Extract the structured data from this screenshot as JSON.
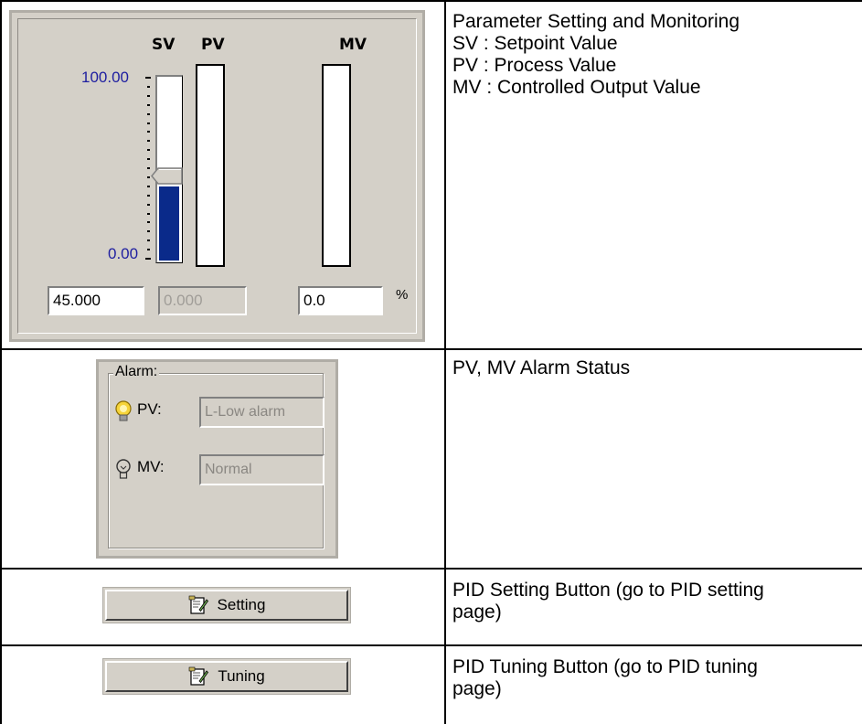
{
  "rows": [
    {
      "description": [
        "Parameter Setting and Monitoring",
        "SV : Setpoint Value",
        "PV : Process Value",
        "MV : Controlled Output Value"
      ]
    },
    {
      "description": [
        "PV, MV Alarm Status"
      ]
    },
    {
      "description": [
        "PID Setting Button (go to PID setting",
        "page)"
      ]
    },
    {
      "description": [
        "PID Tuning Button (go to PID tuning",
        "page)"
      ]
    }
  ],
  "monitor": {
    "headers": {
      "sv": "SV",
      "pv": "PV",
      "mv": "MV"
    },
    "scale_max": "100.00",
    "scale_min": "0.00",
    "sv_value": "45.000",
    "pv_value": "0.000",
    "mv_value": "0.0",
    "unit": "%",
    "sv_level": 0.45,
    "pv_level": 0.0,
    "mv_level": 0.0,
    "scale_color": "#1e1ea0",
    "fill_color": "#0a2a8a"
  },
  "alarm": {
    "group_label": "Alarm:",
    "pv_label": "PV:",
    "pv_status": "L-Low alarm",
    "mv_label": "MV:",
    "mv_status": "Normal",
    "pv_icon": "bulb-lit-icon",
    "mv_icon": "bulb-off-icon"
  },
  "buttons": {
    "setting_label": "Setting",
    "tuning_label": "Tuning",
    "icon": "document-edit-icon"
  }
}
